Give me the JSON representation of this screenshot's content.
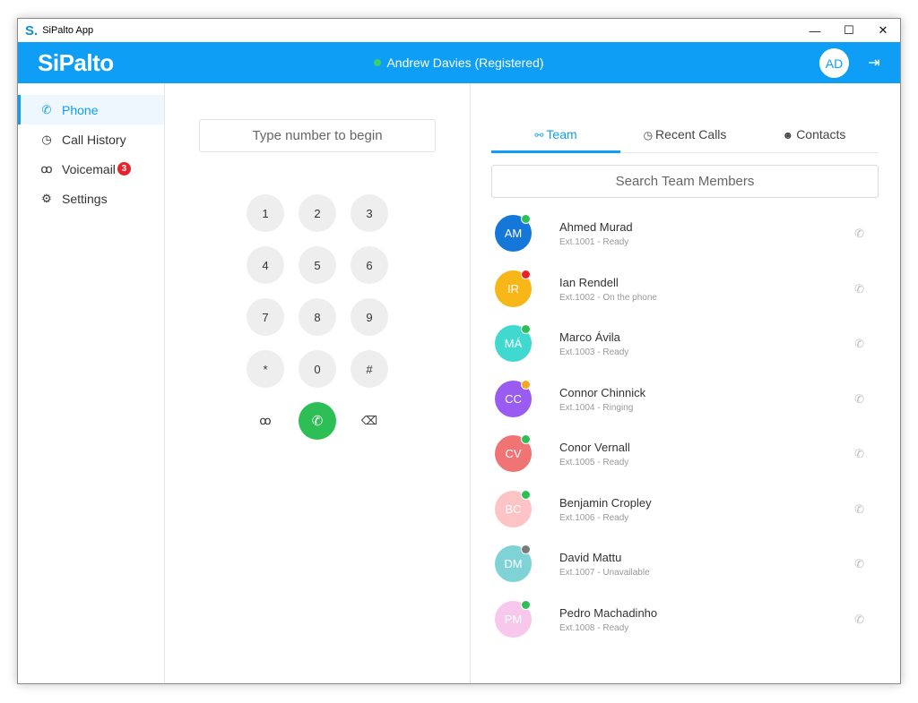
{
  "window": {
    "title": "SiPalto App",
    "logo_letter": "S."
  },
  "appbar": {
    "brand": "SiPalto",
    "status_text": "Andrew Davies  (Registered)",
    "user_initials": "AD",
    "status_color": "#39d06b",
    "accent": "#0e9ef5"
  },
  "sidebar": {
    "items": [
      {
        "label": "Phone",
        "icon": "phone-icon",
        "active": true
      },
      {
        "label": "Call History",
        "icon": "clock-icon"
      },
      {
        "label": "Voicemail",
        "icon": "voicemail-icon",
        "badge": "3"
      },
      {
        "label": "Settings",
        "icon": "gear-icon"
      }
    ]
  },
  "dialer": {
    "placeholder": "Type number to begin",
    "keys": [
      "1",
      "2",
      "3",
      "4",
      "5",
      "6",
      "7",
      "8",
      "9",
      "*",
      "0",
      "#"
    ],
    "voicemail_glyph": "ꝏ",
    "backspace_glyph": "⌫"
  },
  "tabs": [
    {
      "label": "Team",
      "icon": "team-icon",
      "active": true
    },
    {
      "label": "Recent Calls",
      "icon": "clock-icon"
    },
    {
      "label": "Contacts",
      "icon": "contacts-icon"
    }
  ],
  "search": {
    "placeholder": "Search Team Members"
  },
  "members": [
    {
      "initials": "AM",
      "name": "Ahmed Murad",
      "ext": "Ext.1001",
      "state": "Ready",
      "avatar_color": "#1578d9",
      "status_color": "#2dbf55"
    },
    {
      "initials": "IR",
      "name": "Ian Rendell",
      "ext": "Ext.1002",
      "state": "On the phone",
      "avatar_color": "#f7b718",
      "status_color": "#e8222b"
    },
    {
      "initials": "MÁ",
      "name": "Marco Ávila",
      "ext": "Ext.1003",
      "state": "Ready",
      "avatar_color": "#3fd9d0",
      "status_color": "#2dbf55"
    },
    {
      "initials": "CC",
      "name": "Connor Chinnick",
      "ext": "Ext.1004",
      "state": "Ringing",
      "avatar_color": "#9a5cf0",
      "status_color": "#f5a623"
    },
    {
      "initials": "CV",
      "name": "Conor Vernall",
      "ext": "Ext.1005",
      "state": "Ready",
      "avatar_color": "#f07474",
      "status_color": "#2dbf55"
    },
    {
      "initials": "BC",
      "name": "Benjamin Cropley",
      "ext": "Ext.1006",
      "state": "Ready",
      "avatar_color": "#fcc4c4",
      "status_color": "#2dbf55"
    },
    {
      "initials": "DM",
      "name": "David Mattu",
      "ext": "Ext.1007",
      "state": "Unavailable",
      "avatar_color": "#7fd3d6",
      "status_color": "#7a7a7a"
    },
    {
      "initials": "PM",
      "name": "Pedro Machadinho",
      "ext": "Ext.1008",
      "state": "Ready",
      "avatar_color": "#f7c8ec",
      "status_color": "#2dbf55"
    }
  ]
}
